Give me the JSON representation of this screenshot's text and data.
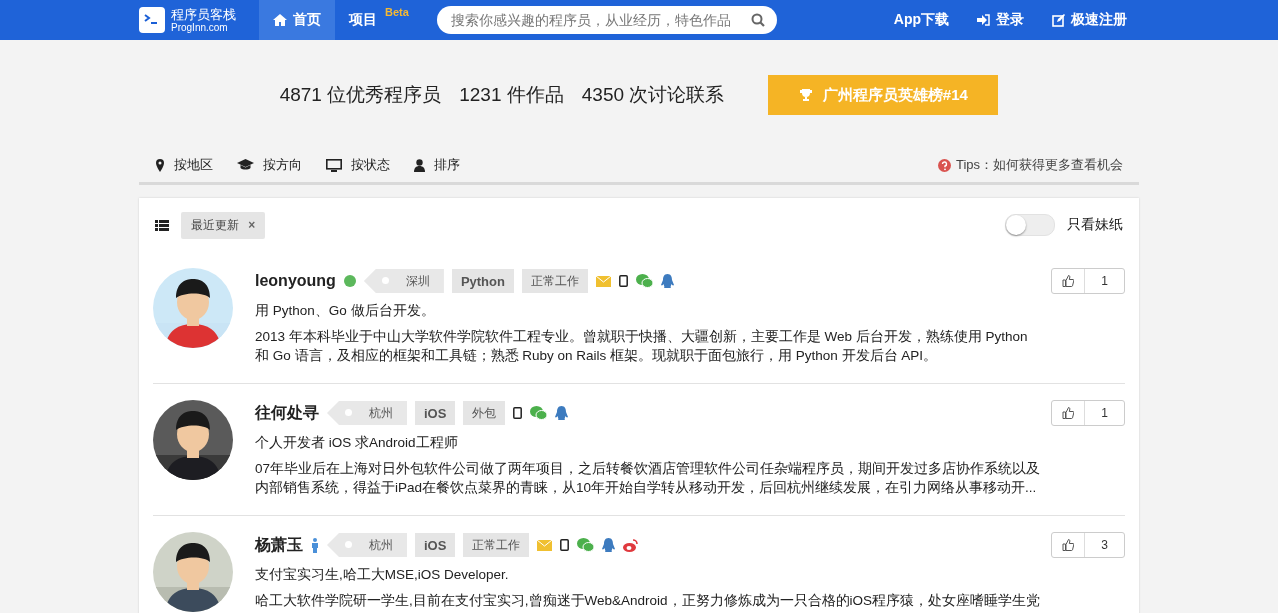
{
  "header": {
    "logo_title": "程序员客栈",
    "logo_subtitle": "ProgInn.com",
    "nav": [
      {
        "label": "首页",
        "selected": true
      },
      {
        "label": "项目",
        "selected": false,
        "sup": "Beta"
      }
    ],
    "search": {
      "placeholder": "搜索你感兴趣的程序员，从业经历，特色作品"
    },
    "links": [
      {
        "label": "App下载"
      },
      {
        "label": "登录"
      },
      {
        "label": "极速注册"
      }
    ]
  },
  "stats": [
    "4871 位优秀程序员",
    "1231 件作品",
    "4350 次讨论联系"
  ],
  "ranking_button": "广州程序员英雄榜#14",
  "filters": [
    {
      "label": "按地区"
    },
    {
      "label": "按方向"
    },
    {
      "label": "按状态"
    },
    {
      "label": "排序"
    }
  ],
  "tips": "Tips：如何获得更多查看机会",
  "active_filter": {
    "label": "最近更新",
    "remove": "×"
  },
  "toggle": {
    "label": "只看妹纸",
    "on": false
  },
  "profiles": [
    {
      "name": "leonyoung",
      "badge": {
        "kind": "online"
      },
      "city": "深圳",
      "skill": "Python",
      "work": "正常工作",
      "contacts": [
        {
          "kind": "mail"
        },
        {
          "kind": "phone"
        },
        {
          "kind": "wechat"
        },
        {
          "kind": "qq"
        }
      ],
      "likes": "1",
      "summary": "用 Python、Go 做后台开发。",
      "bio": "2013 年本科毕业于中山大学软件学院软件工程专业。曾就职于快播、大疆创新，主要工作是 Web 后台开发，熟练使用 Python 和 Go 语言，及相应的框架和工具链；熟悉 Ruby on Rails 框架。现就职于面包旅行，用 Python 开发后台 API。"
    },
    {
      "name": "往何处寻",
      "city": "杭州",
      "skill": "iOS",
      "work": "外包",
      "contacts": [
        {
          "kind": "phone"
        },
        {
          "kind": "wechat"
        },
        {
          "kind": "qq"
        }
      ],
      "likes": "1",
      "summary": "个人开发者 iOS 求Android工程师",
      "bio": "07年毕业后在上海对日外包软件公司做了两年项目，之后转餐饮酒店管理软件公司任杂端程序员，期间开发过多店协作系统以及内部销售系统，得益于iPad在餐饮点菜界的青睐，从10年开始自学转从移动开发，后回杭州继续发展，在引力网络从事移动开..."
    },
    {
      "name": "杨萧玉",
      "badge": {
        "kind": "male"
      },
      "city": "杭州",
      "skill": "iOS",
      "work": "正常工作",
      "contacts": [
        {
          "kind": "mail"
        },
        {
          "kind": "phone"
        },
        {
          "kind": "wechat"
        },
        {
          "kind": "qq"
        },
        {
          "kind": "weibo"
        }
      ],
      "likes": "3",
      "summary": "支付宝实习生,哈工大MSE,iOS Developer.",
      "bio": "哈工大软件学院研一学生,目前在支付宝实习,曾痴迷于Web&Android，正努力修炼成为一只合格的iOS程序猿，处女座嗜睡学生党"
    }
  ]
}
